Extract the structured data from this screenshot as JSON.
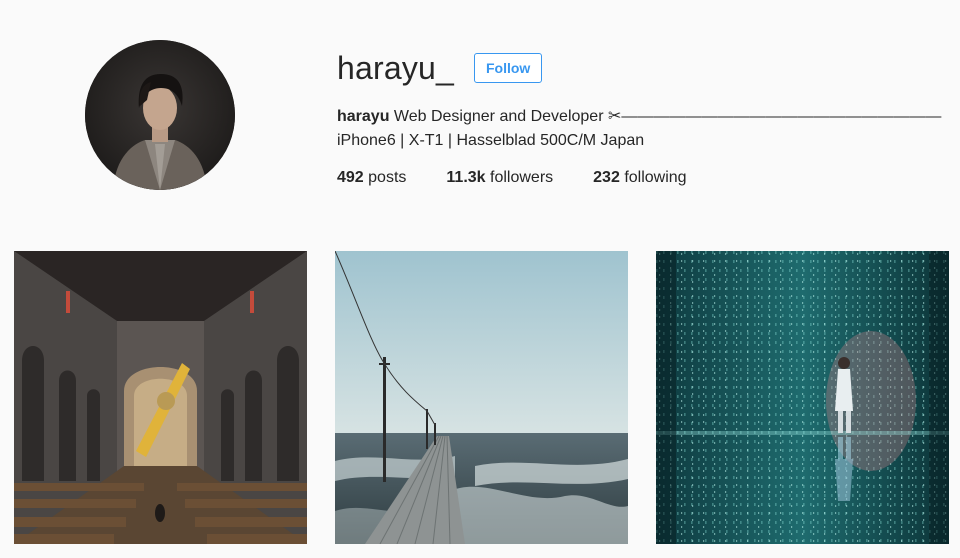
{
  "profile": {
    "username": "harayu_",
    "follow_label": "Follow",
    "bio_name": "harayu",
    "bio_text": "Web Designer and Developer ✂———————————————————— iPhone6 | X-T1 | Hasselblad 500C/M Japan"
  },
  "stats": {
    "posts_count": "492",
    "posts_label": "posts",
    "followers_count": "11.3k",
    "followers_label": "followers",
    "following_count": "232",
    "following_label": "following"
  },
  "colors": {
    "accent": "#3897f0",
    "background": "#fafafa",
    "text": "#262626"
  }
}
